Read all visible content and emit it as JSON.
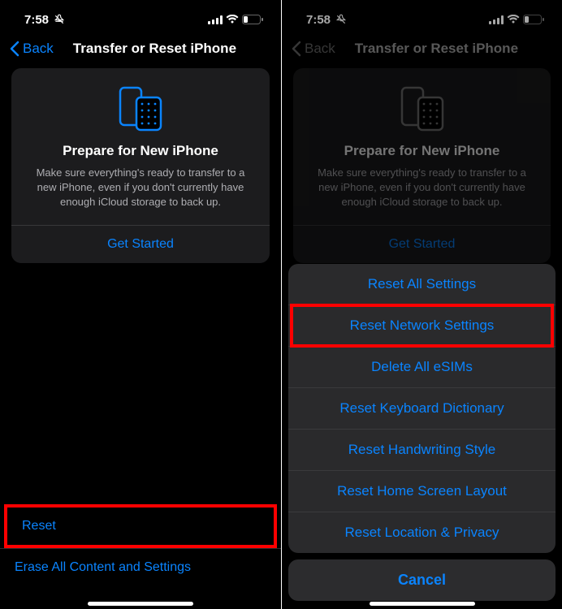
{
  "status": {
    "time": "7:58"
  },
  "nav": {
    "back": "Back",
    "title": "Transfer or Reset iPhone"
  },
  "card": {
    "title": "Prepare for New iPhone",
    "body": "Make sure everything's ready to transfer to a new iPhone, even if you don't currently have enough iCloud storage to back up.",
    "action": "Get Started"
  },
  "list": {
    "reset": "Reset",
    "erase": "Erase All Content and Settings"
  },
  "sheet": {
    "items": [
      "Reset All Settings",
      "Reset Network Settings",
      "Delete All eSIMs",
      "Reset Keyboard Dictionary",
      "Reset Handwriting Style",
      "Reset Home Screen Layout",
      "Reset Location & Privacy"
    ],
    "cancel": "Cancel"
  },
  "colors": {
    "accent": "#0a84ff",
    "highlight": "#ff0000"
  }
}
